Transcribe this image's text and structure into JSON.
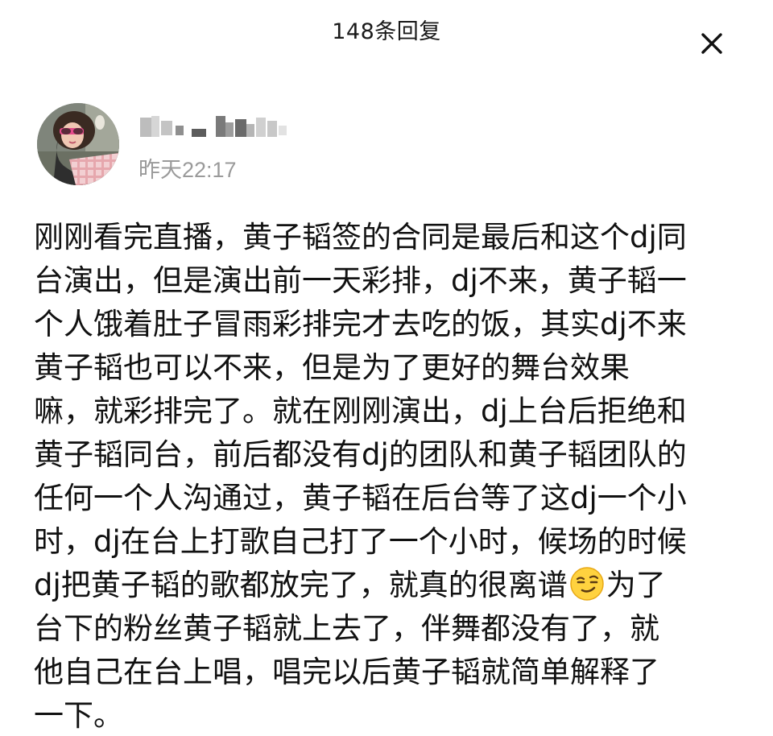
{
  "header": {
    "title": "148条回复"
  },
  "comment": {
    "timestamp": "昨天22:17",
    "lines": [
      "刚刚看完直播，黄子韬签的合同是最后和这个dj同",
      "台演出，但是演出前一天彩排，dj不来，黄子韬一",
      "个人饿着肚子冒雨彩排完才去吃的饭，其实dj不来",
      "黄子韬也可以不来，但是为了更好的舞台效果",
      "嘛，就彩排完了。就在刚刚演出，dj上台后拒绝和",
      "黄子韬同台，前后都没有dj的团队和黄子韬团队的",
      "任何一个人沟通过，黄子韬在后台等了这dj一个小",
      "时，dj在台上打歌自己打了一个小时，候场的时候"
    ],
    "line9_before_emoji": "dj把黄子韬的歌都放完了，就真的很离谱",
    "line9_after_emoji": "为了",
    "lines_after": [
      "台下的粉丝黄子韬就上去了，伴舞都没有了，就",
      "他自己在台上唱，唱完以后黄子韬就简单解释了",
      "一下。"
    ]
  },
  "icons": {
    "close": "close-icon",
    "emoji": "smirk-emoji-icon",
    "username": "blurred-username"
  },
  "colors": {
    "background": "#ffffff",
    "text": "#111111",
    "timestamp": "#9a9a9a"
  }
}
